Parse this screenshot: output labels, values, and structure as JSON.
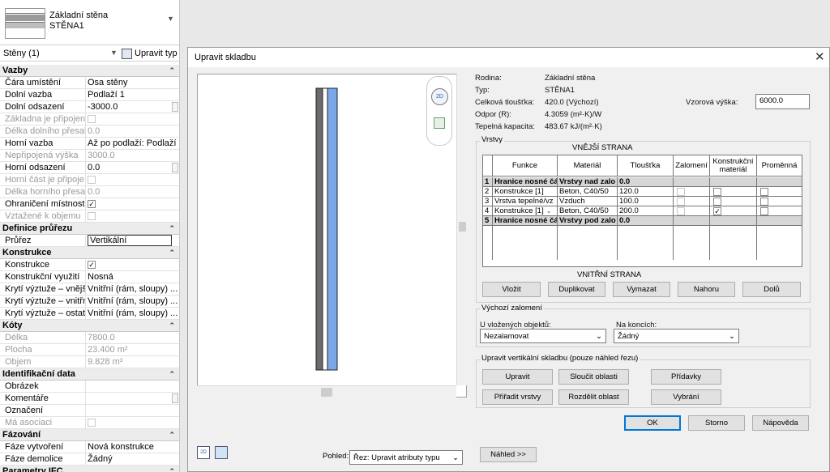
{
  "type_selector": {
    "family": "Základní stěna",
    "type": "STĚNA1"
  },
  "instance_bar": {
    "label": "Stěny (1)",
    "edit_type_label": "Upravit typ"
  },
  "properties": [
    {
      "kind": "group",
      "label": "Vazby"
    },
    {
      "kind": "row",
      "key": "Čára umístění",
      "value": "Osa stěny"
    },
    {
      "kind": "row",
      "key": "Dolní vazba",
      "value": "Podlaží 1"
    },
    {
      "kind": "row",
      "key": "Dolní odsazení",
      "value": "-3000.0",
      "side": true
    },
    {
      "kind": "row",
      "key": "Základna je připojena.",
      "check": "",
      "disabled": true
    },
    {
      "kind": "row",
      "key": "Délka dolního přesahu",
      "value": "0.0",
      "disabled": true
    },
    {
      "kind": "row",
      "key": "Horní vazba",
      "value": "Až po podlaží: Podlaží 1"
    },
    {
      "kind": "row",
      "key": "Nepřipojená výška",
      "value": "3000.0",
      "disabled": true
    },
    {
      "kind": "row",
      "key": "Horní odsazení",
      "value": "0.0",
      "side": true
    },
    {
      "kind": "row",
      "key": "Horní část je připoje...",
      "check": "",
      "disabled": true
    },
    {
      "kind": "row",
      "key": "Délka horního přesahu",
      "value": "0.0",
      "disabled": true
    },
    {
      "kind": "row",
      "key": "Ohraničení místnosti",
      "check": "✓"
    },
    {
      "kind": "row",
      "key": "Vztažené k objemu",
      "check": "",
      "disabled": true
    },
    {
      "kind": "group",
      "label": "Definice průřezu"
    },
    {
      "kind": "row",
      "key": "Průřez",
      "value": "Vertikální",
      "editing": true
    },
    {
      "kind": "group",
      "label": "Konstrukce"
    },
    {
      "kind": "row",
      "key": "Konstrukce",
      "check": "✓"
    },
    {
      "kind": "row",
      "key": "Konstrukční využití",
      "value": "Nosná"
    },
    {
      "kind": "row",
      "key": "Krytí výztuže – vnější ...",
      "value": "Vnitřní (rám, sloupy) ..."
    },
    {
      "kind": "row",
      "key": "Krytí výztuže – vnitřn...",
      "value": "Vnitřní (rám, sloupy) ..."
    },
    {
      "kind": "row",
      "key": "Krytí výztuže – ostatn...",
      "value": "Vnitřní (rám, sloupy) ..."
    },
    {
      "kind": "group",
      "label": "Kóty"
    },
    {
      "kind": "row",
      "key": "Délka",
      "value": "7800.0",
      "disabled": true
    },
    {
      "kind": "row",
      "key": "Plocha",
      "value": "23.400 m²",
      "disabled": true
    },
    {
      "kind": "row",
      "key": "Objem",
      "value": "9.828 m³",
      "disabled": true
    },
    {
      "kind": "group",
      "label": "Identifikační data"
    },
    {
      "kind": "row",
      "key": "Obrázek",
      "value": ""
    },
    {
      "kind": "row",
      "key": "Komentáře",
      "value": "",
      "side": true
    },
    {
      "kind": "row",
      "key": "Označení",
      "value": ""
    },
    {
      "kind": "row",
      "key": "Má asociaci",
      "check": "",
      "disabled": true
    },
    {
      "kind": "group",
      "label": "Fázování"
    },
    {
      "kind": "row",
      "key": "Fáze vytvoření",
      "value": "Nová konstrukce"
    },
    {
      "kind": "row",
      "key": "Fáze demolice",
      "value": "Žádný"
    },
    {
      "kind": "group",
      "label": "Parametry IFC"
    }
  ],
  "dialog": {
    "title": "Upravit skladbu",
    "close_glyph": "✕",
    "info": [
      {
        "label": "Rodina:",
        "value": "Základní stěna"
      },
      {
        "label": "Typ:",
        "value": "STĚNA1"
      },
      {
        "label": "Celková tloušťka:",
        "value": "420.0 (Výchozí)"
      },
      {
        "label": "Odpor (R):",
        "value": "4.3059 (m²·K)/W"
      },
      {
        "label": "Tepelná kapacita:",
        "value": "483.67 kJ/(m²·K)"
      }
    ],
    "sample_height_label": "Vzorová výška:",
    "sample_height_value": "6000.0",
    "layers_label": "Vrstvy",
    "outer_side": "VNĚJŠÍ STRANA",
    "inner_side": "VNITŘNÍ STRANA",
    "columns": [
      "",
      "Funkce",
      "Materiál",
      "Tloušťka",
      "Zalomení",
      "Konstrukční materiál",
      "Proměnná"
    ],
    "layers": [
      {
        "n": "1",
        "func": "Hranice nosné čá",
        "mat": "Vrstvy nad zalo",
        "thk": "0.0",
        "core": true
      },
      {
        "n": "2",
        "func": "Konstrukce [1]",
        "mat": "Beton, C40/50",
        "thk": "120.0",
        "wrap": "",
        "struct": "",
        "var": ""
      },
      {
        "n": "3",
        "func": "Vrstva tepelné/vz",
        "mat": "Vzduch",
        "thk": "100.0",
        "wrap": "",
        "struct": "",
        "var": ""
      },
      {
        "n": "4",
        "func": "Konstrukce [1]",
        "mat": "Beton, C40/50",
        "thk": "200.0",
        "wrap": "",
        "struct": "✓",
        "var": "",
        "dropdown": true
      },
      {
        "n": "5",
        "func": "Hranice nosné čá",
        "mat": "Vrstvy pod zalo",
        "thk": "0.0",
        "core": true
      }
    ],
    "layer_buttons": [
      "Vložit",
      "Duplikovat",
      "Vymazat",
      "Nahoru",
      "Dolů"
    ],
    "wrap_group_label": "Výchozí zalomení",
    "insert_label": "U vložených objektů:",
    "insert_value": "Nezalamovat",
    "ends_label": "Na koncích:",
    "ends_value": "Žádný",
    "vert_group_label": "Upravit vertikální skladbu (pouze náhled řezu)",
    "vert_buttons_row1": [
      "Upravit",
      "Sloučit oblasti",
      "Přídavky"
    ],
    "vert_buttons_row2": [
      "Přiřadit vrstvy",
      "Rozdělit oblast",
      "Vybrání"
    ],
    "ok_label": "OK",
    "cancel_label": "Storno",
    "help_label": "Nápověda",
    "view_label": "Pohled:",
    "view_value": "Řez: Upravit atributy typu",
    "preview_button": "Náhled >>",
    "nav_wheel_text": "2D"
  },
  "colors": {
    "accent": "#0078d7",
    "layer_insulation": "#7aa7e8",
    "layer_concrete": "#6b6b6b"
  }
}
